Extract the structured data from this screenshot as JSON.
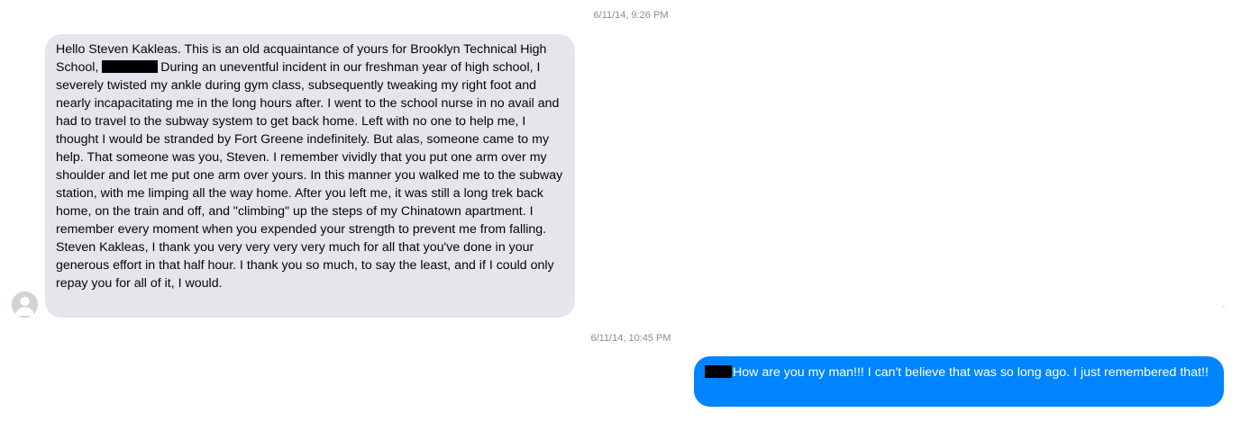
{
  "conversation": {
    "messages": [
      {
        "timestamp": "6/11/14, 9:26 PM",
        "direction": "incoming",
        "text_before_redaction": "Hello Steven Kakleas. This is an old acquaintance of yours for Brooklyn Technical High School,",
        "text_after_redaction": "During an uneventful incident in our freshman year of high school, I severely twisted my ankle during gym class, subsequently tweaking my right foot and nearly incapacitating me in the long hours after. I went to the school nurse in no avail and had to travel to the subway system to get back home. Left with no one to help me, I thought I would be stranded by Fort Greene indefinitely. But alas, someone came to my help. That someone was you, Steven. I remember vividly that you put one arm over my shoulder and let me put one arm over yours. In this manner you walked me to the subway station, with me limping all the way home. After you left me, it was still a long trek back home, on the train and off, and \"climbing\" up the steps of my Chinatown apartment. I remember every moment when you expended your strength to prevent me from falling. Steven Kakleas, I thank you very very very very much for all that you've done in your generous effort in that half hour. I thank you so much, to say the least, and if I could only repay you for all of it, I would."
      },
      {
        "timestamp": "6/11/14, 10:45 PM",
        "direction": "outgoing",
        "text_after_redaction": "How are you my man!!! I can't believe that was so long ago. I just remembered that!!"
      }
    ],
    "colors": {
      "incoming_bubble": "#e4e6eb",
      "outgoing_bubble": "#0084ff",
      "timestamp_text": "#8a8d91"
    },
    "icons": {
      "avatar": "default-person-avatar-icon"
    }
  }
}
